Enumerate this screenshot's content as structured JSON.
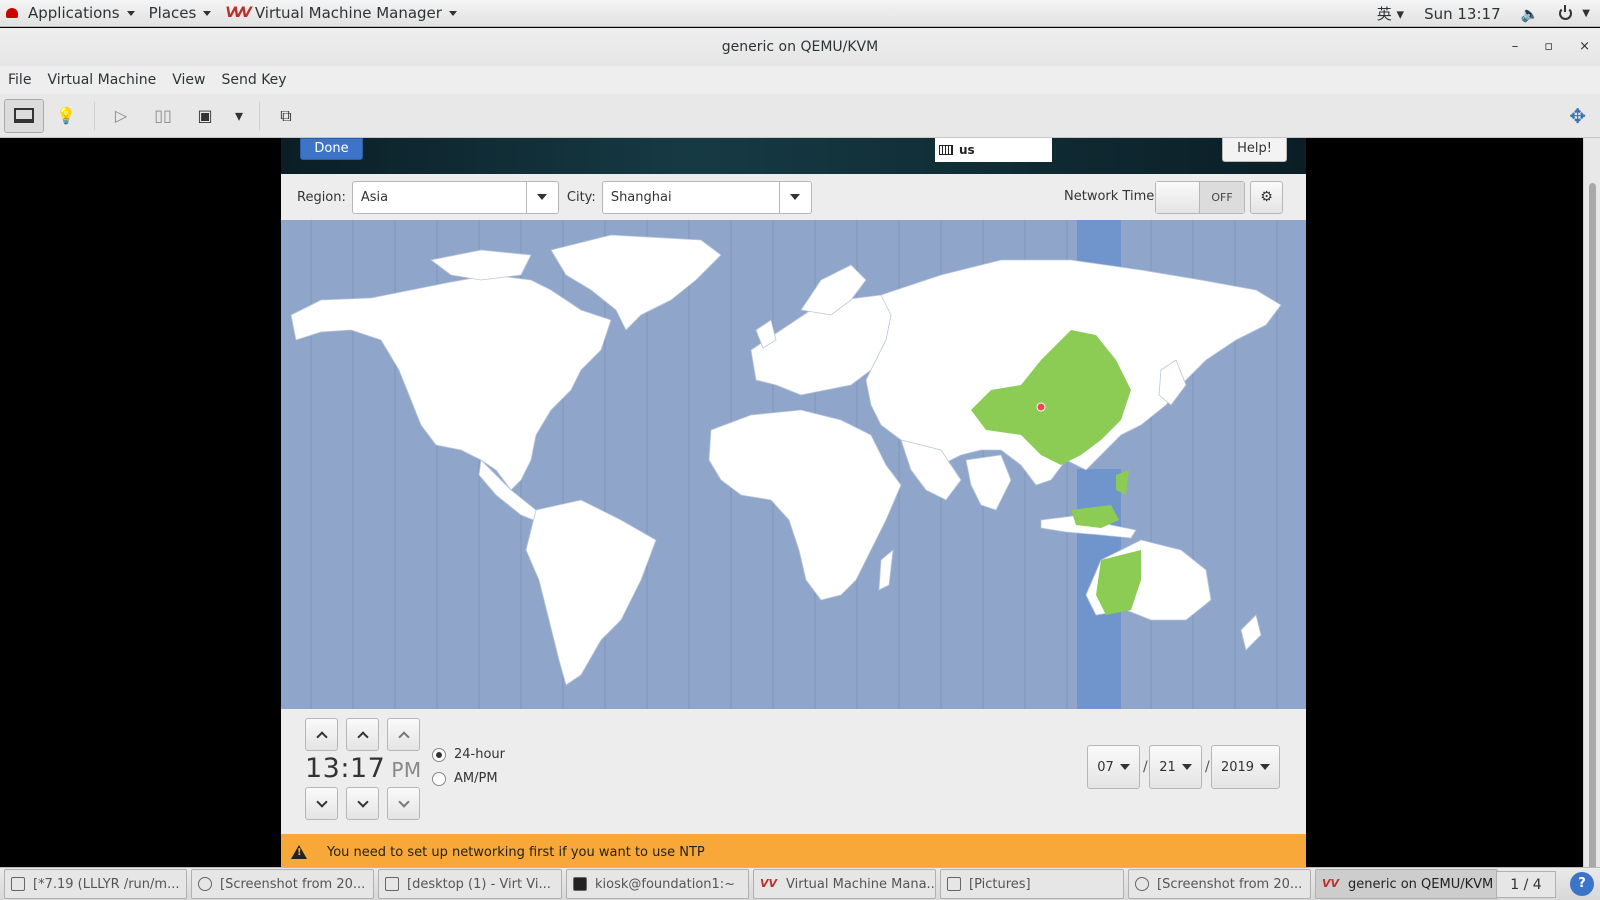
{
  "top_panel": {
    "applications": "Applications",
    "places": "Places",
    "app_name": "Virtual Machine Manager",
    "input_method": "英",
    "clock": "Sun 13:17"
  },
  "window": {
    "title": "generic on QEMU/KVM",
    "controls": {
      "minimize": "–",
      "maximize": "▫",
      "close": "×"
    }
  },
  "menubar": [
    "File",
    "Virtual Machine",
    "View",
    "Send Key"
  ],
  "guest": {
    "done_label": "Done",
    "keyboard_layout": "us",
    "help_label": "Help!",
    "region_label": "Region:",
    "region_value": "Asia",
    "city_label": "City:",
    "city_value": "Shanghai",
    "network_time_label": "Network Time",
    "network_time_state": "OFF",
    "clock_time": "13:17",
    "clock_ampm": "PM",
    "format_24h": "24-hour",
    "format_ampm": "AM/PM",
    "format_selected": "24-hour",
    "date_month": "07",
    "date_day": "21",
    "date_year": "2019",
    "date_sep": "/",
    "warning": "You need to set up networking first if you want to use NTP",
    "colors": {
      "ocean": "#8fa5c9",
      "selected_zone": "#6f95cc",
      "land": "#ffffff",
      "highlight_land": "#8ccc55",
      "pin": "#e84a4a"
    }
  },
  "taskbar": {
    "items": [
      "[*7.19 (LLLYR /run/m...",
      "[Screenshot from 20...",
      "[desktop (1) - Virt Vi...",
      "kiosk@foundation1:~",
      "Virtual Machine Mana...",
      "[Pictures]",
      "[Screenshot from 20...",
      "generic on QEMU/KVM"
    ],
    "workspace": "1 / 4",
    "help": "?"
  }
}
